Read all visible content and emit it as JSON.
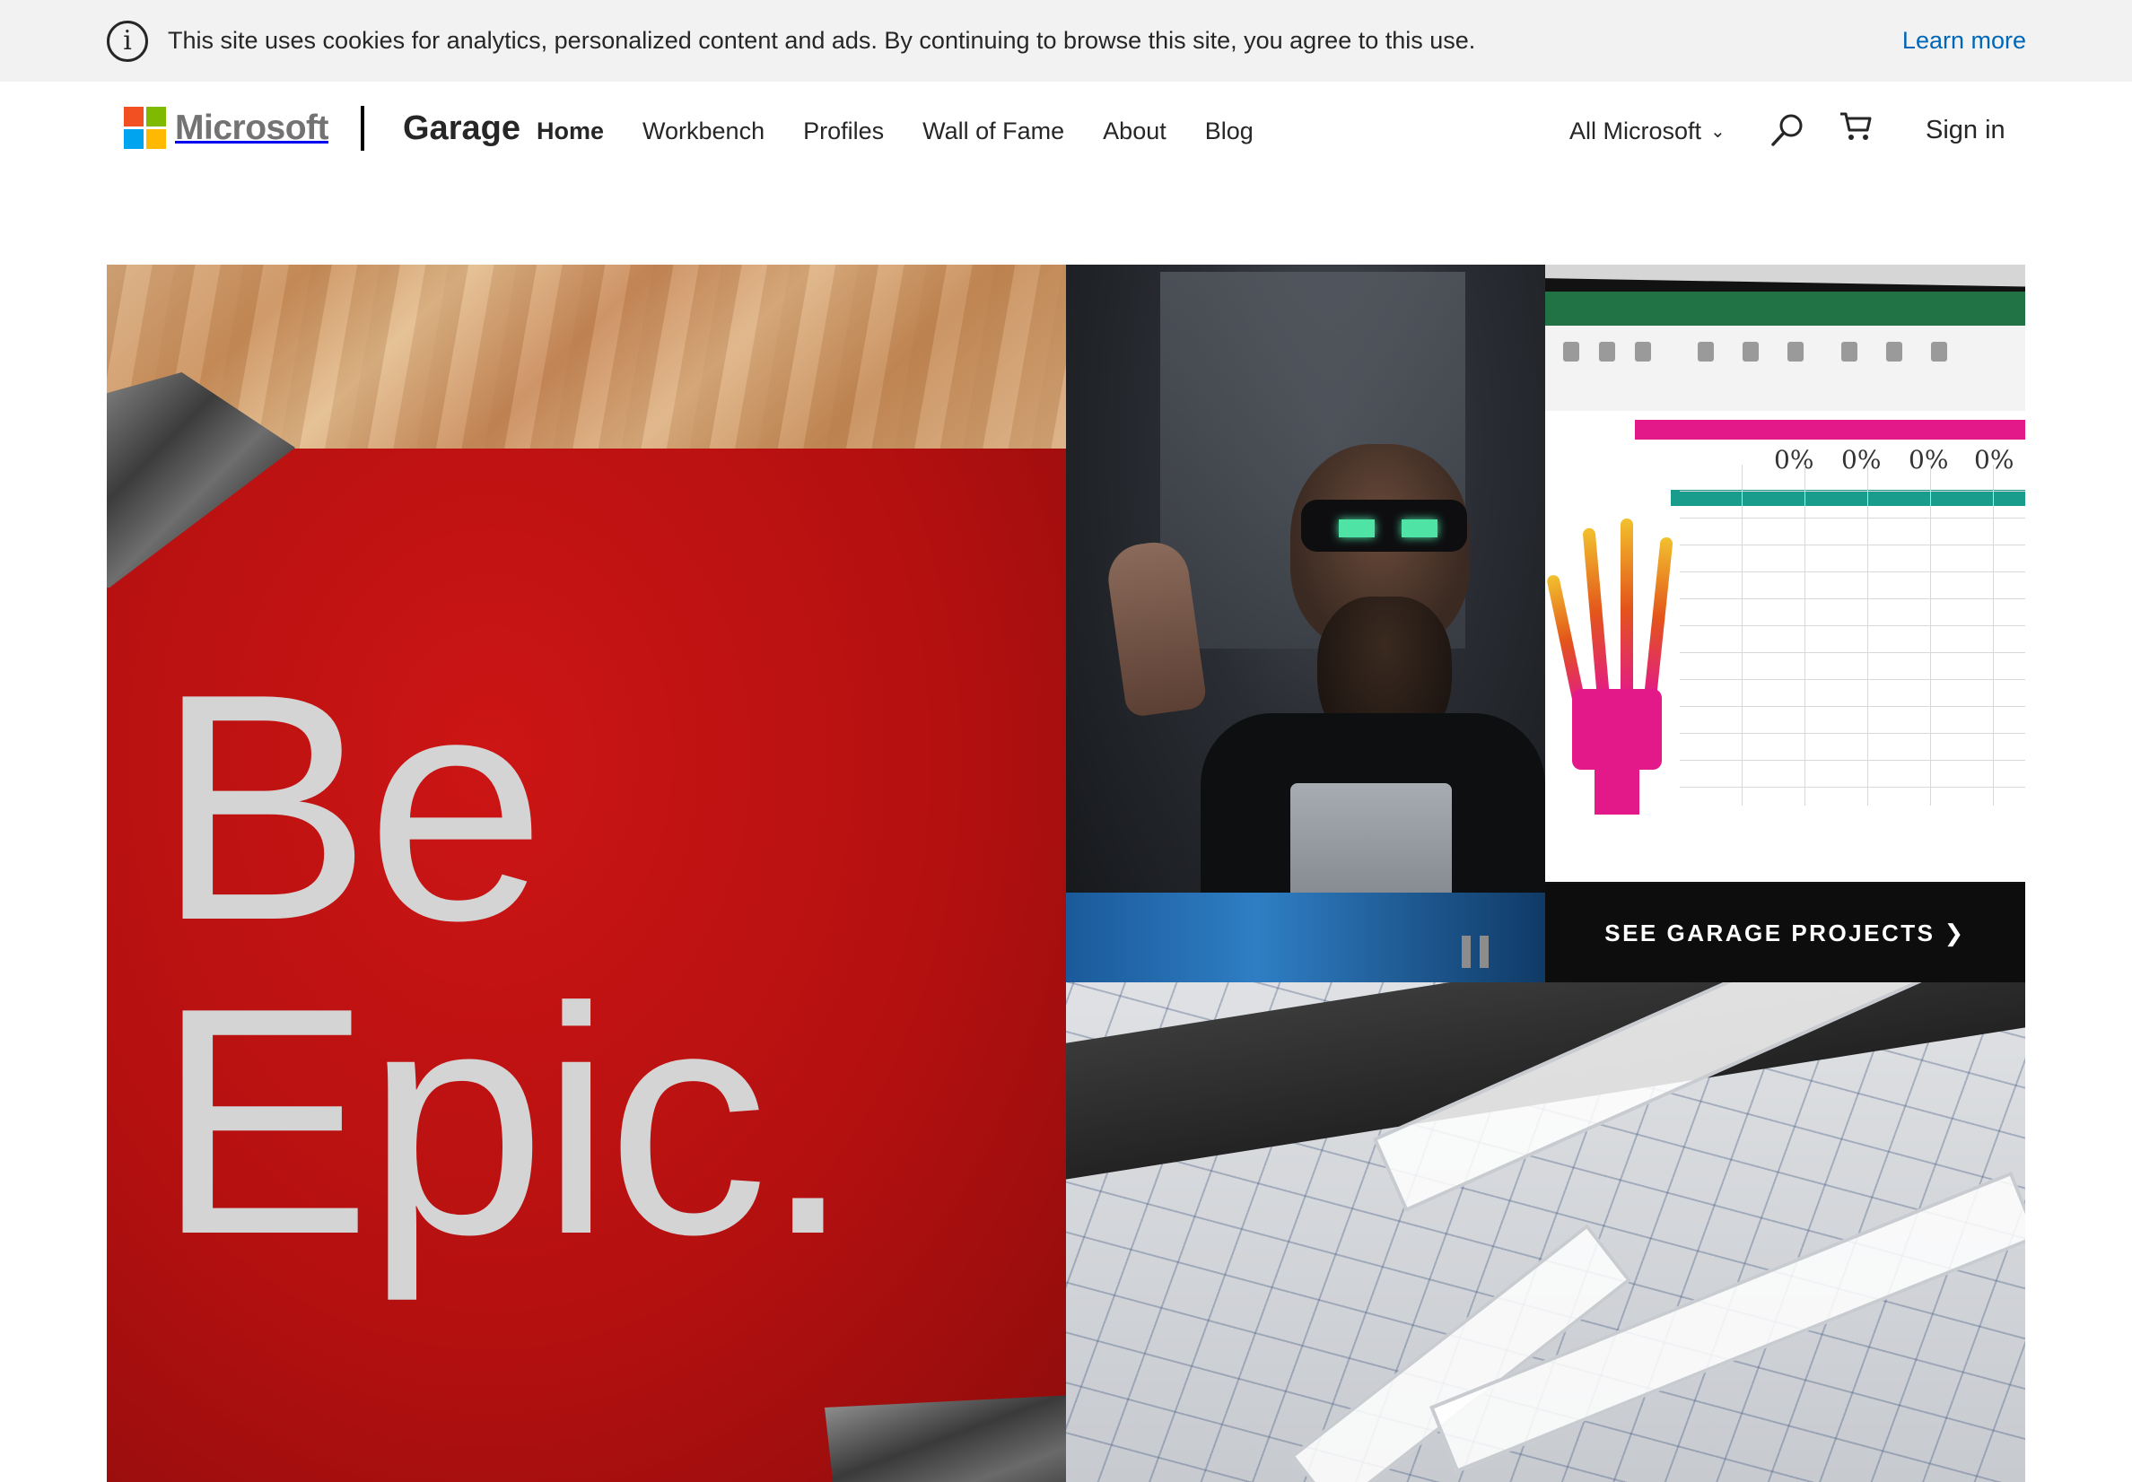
{
  "cookie_banner": {
    "message": "This site uses cookies for analytics, personalized content and ads. By continuing to browse this site, you agree to this use.",
    "learn_more": "Learn more",
    "icon": "info-icon"
  },
  "header": {
    "logo_text": "Microsoft",
    "site_name": "Garage",
    "nav": [
      {
        "label": "Home",
        "active": true
      },
      {
        "label": "Workbench"
      },
      {
        "label": "Profiles"
      },
      {
        "label": "Wall of Fame"
      },
      {
        "label": "About"
      },
      {
        "label": "Blog"
      }
    ],
    "all_microsoft": "All Microsoft",
    "search_icon": "search-icon",
    "cart_icon": "cart-icon",
    "sign_in": "Sign in"
  },
  "hero": {
    "headline_line1": "Be",
    "headline_line2": "Epic.",
    "cta_label": "SEE GARAGE PROJECTS",
    "excel_values": [
      "0%",
      "0%",
      "0%",
      "0%"
    ],
    "colors": {
      "red": "#c41212",
      "text_gray": "#d4d4d4",
      "excel_green": "#217346",
      "magenta": "#e3198a",
      "teal": "#1a9c8c"
    }
  },
  "colors": {
    "link_blue": "#0067b8",
    "banner_bg": "#f2f2f2",
    "ms_red": "#f25022",
    "ms_green": "#7fba00",
    "ms_blue": "#00a4ef",
    "ms_yellow": "#ffb900"
  }
}
